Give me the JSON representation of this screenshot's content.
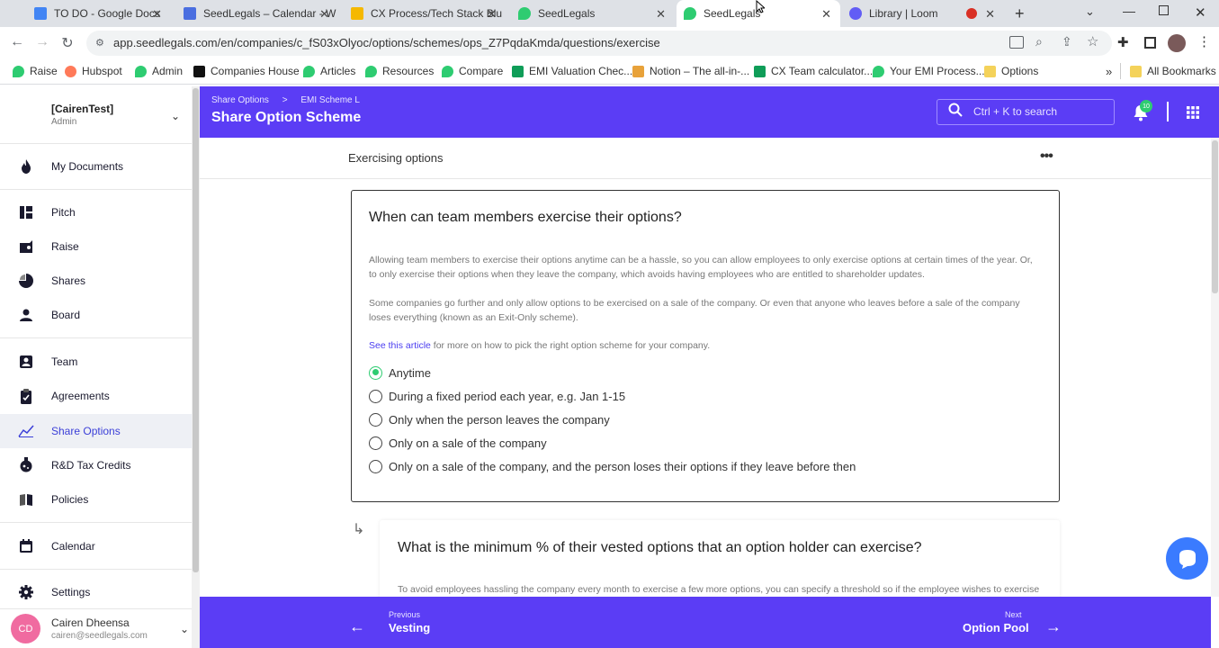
{
  "browser": {
    "tabs": [
      {
        "title": "TO DO - Google Docs",
        "color": "#4285f4"
      },
      {
        "title": "SeedLegals – Calendar - W",
        "color": "#4a6ee0"
      },
      {
        "title": "CX Process/Tech Stack Blu",
        "color": "#f5b800"
      },
      {
        "title": "SeedLegals",
        "color": "#2ecc71"
      },
      {
        "title": "SeedLegals",
        "color": "#2ecc71",
        "active": true
      },
      {
        "title": "Library | Loom",
        "color": "#625df5"
      }
    ],
    "url": "app.seedlegals.com/en/companies/c_fS03xOlyoc/options/schemes/ops_Z7PqdaKmda/questions/exercise",
    "bookmarks": [
      "Raise",
      "Hubspot",
      "Admin",
      "Companies House",
      "Articles",
      "Resources",
      "Compare",
      "EMI Valuation Chec...",
      "Notion – The all-in-...",
      "CX Team calculator...",
      "Your EMI Process...",
      "Options"
    ],
    "all_bookmarks": "All Bookmarks",
    "overflow": "»"
  },
  "sidebar": {
    "company": "[CairenTest]",
    "role": "Admin",
    "items": [
      {
        "label": "My Documents",
        "icon": "flame-icon"
      },
      {
        "label": "Pitch",
        "icon": "pitch-icon"
      },
      {
        "label": "Raise",
        "icon": "raise-icon"
      },
      {
        "label": "Shares",
        "icon": "pie-chart-icon"
      },
      {
        "label": "Board",
        "icon": "board-icon"
      },
      {
        "label": "Team",
        "icon": "team-icon"
      },
      {
        "label": "Agreements",
        "icon": "clipboard-icon"
      },
      {
        "label": "Share Options",
        "icon": "line-chart-icon",
        "active": true
      },
      {
        "label": "R&D Tax Credits",
        "icon": "flask-icon"
      },
      {
        "label": "Policies",
        "icon": "book-icon"
      },
      {
        "label": "Calendar",
        "icon": "calendar-icon"
      },
      {
        "label": "Settings",
        "icon": "gear-icon"
      }
    ],
    "user": {
      "initials": "CD",
      "name": "Cairen Dheensa",
      "email": "cairen@seedlegals.com"
    }
  },
  "header": {
    "breadcrumb_1": "Share Options",
    "breadcrumb_sep": ">",
    "breadcrumb_2": "EMI Scheme L",
    "title": "Share Option Scheme",
    "search_placeholder": "Ctrl + K  to search",
    "notification_count": "10"
  },
  "content": {
    "section_title": "Exercising options",
    "question1": {
      "title": "When can team members exercise their options?",
      "para1": "Allowing team members to exercise their options anytime can be a hassle, so you can allow employees to only exercise options at certain times of the year. Or, to only exercise their options when they leave the company, which avoids having employees who are entitled to shareholder updates.",
      "para2": "Some companies go further and only allow options to be exercised on a sale of the company. Or even that anyone who leaves before a sale of the company loses everything (known as an Exit-Only scheme).",
      "link": "See this article",
      "link_suffix": " for more on how to pick the right option scheme for your company.",
      "options": [
        "Anytime",
        "During a fixed period each year, e.g. Jan 1-15",
        "Only when the person leaves the company",
        "Only on a sale of the company",
        "Only on a sale of the company, and the person loses their options if they leave before then"
      ],
      "selected": "Anytime"
    },
    "question2": {
      "title": "What is the minimum % of their vested options that an option holder can exercise?",
      "desc": "To avoid employees hassling the company every month to exercise a few more options, you can specify a threshold so if the employee wishes to exercise"
    }
  },
  "footer": {
    "prev_small": "Previous",
    "prev_label": "Vesting",
    "next_small": "Next",
    "next_label": "Option Pool"
  },
  "colors": {
    "brand": "#5b3df5",
    "selected": "#2ecc71",
    "link": "#4a3df0"
  }
}
